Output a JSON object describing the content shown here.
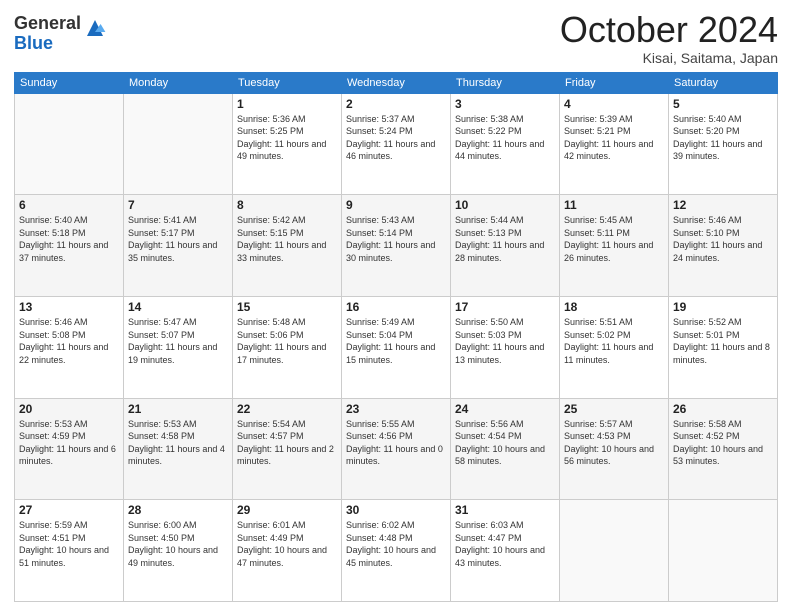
{
  "header": {
    "logo_general": "General",
    "logo_blue": "Blue",
    "month_title": "October 2024",
    "location": "Kisai, Saitama, Japan"
  },
  "weekdays": [
    "Sunday",
    "Monday",
    "Tuesday",
    "Wednesday",
    "Thursday",
    "Friday",
    "Saturday"
  ],
  "weeks": [
    [
      {
        "day": "",
        "info": ""
      },
      {
        "day": "",
        "info": ""
      },
      {
        "day": "1",
        "info": "Sunrise: 5:36 AM\nSunset: 5:25 PM\nDaylight: 11 hours and 49 minutes."
      },
      {
        "day": "2",
        "info": "Sunrise: 5:37 AM\nSunset: 5:24 PM\nDaylight: 11 hours and 46 minutes."
      },
      {
        "day": "3",
        "info": "Sunrise: 5:38 AM\nSunset: 5:22 PM\nDaylight: 11 hours and 44 minutes."
      },
      {
        "day": "4",
        "info": "Sunrise: 5:39 AM\nSunset: 5:21 PM\nDaylight: 11 hours and 42 minutes."
      },
      {
        "day": "5",
        "info": "Sunrise: 5:40 AM\nSunset: 5:20 PM\nDaylight: 11 hours and 39 minutes."
      }
    ],
    [
      {
        "day": "6",
        "info": "Sunrise: 5:40 AM\nSunset: 5:18 PM\nDaylight: 11 hours and 37 minutes."
      },
      {
        "day": "7",
        "info": "Sunrise: 5:41 AM\nSunset: 5:17 PM\nDaylight: 11 hours and 35 minutes."
      },
      {
        "day": "8",
        "info": "Sunrise: 5:42 AM\nSunset: 5:15 PM\nDaylight: 11 hours and 33 minutes."
      },
      {
        "day": "9",
        "info": "Sunrise: 5:43 AM\nSunset: 5:14 PM\nDaylight: 11 hours and 30 minutes."
      },
      {
        "day": "10",
        "info": "Sunrise: 5:44 AM\nSunset: 5:13 PM\nDaylight: 11 hours and 28 minutes."
      },
      {
        "day": "11",
        "info": "Sunrise: 5:45 AM\nSunset: 5:11 PM\nDaylight: 11 hours and 26 minutes."
      },
      {
        "day": "12",
        "info": "Sunrise: 5:46 AM\nSunset: 5:10 PM\nDaylight: 11 hours and 24 minutes."
      }
    ],
    [
      {
        "day": "13",
        "info": "Sunrise: 5:46 AM\nSunset: 5:08 PM\nDaylight: 11 hours and 22 minutes."
      },
      {
        "day": "14",
        "info": "Sunrise: 5:47 AM\nSunset: 5:07 PM\nDaylight: 11 hours and 19 minutes."
      },
      {
        "day": "15",
        "info": "Sunrise: 5:48 AM\nSunset: 5:06 PM\nDaylight: 11 hours and 17 minutes."
      },
      {
        "day": "16",
        "info": "Sunrise: 5:49 AM\nSunset: 5:04 PM\nDaylight: 11 hours and 15 minutes."
      },
      {
        "day": "17",
        "info": "Sunrise: 5:50 AM\nSunset: 5:03 PM\nDaylight: 11 hours and 13 minutes."
      },
      {
        "day": "18",
        "info": "Sunrise: 5:51 AM\nSunset: 5:02 PM\nDaylight: 11 hours and 11 minutes."
      },
      {
        "day": "19",
        "info": "Sunrise: 5:52 AM\nSunset: 5:01 PM\nDaylight: 11 hours and 8 minutes."
      }
    ],
    [
      {
        "day": "20",
        "info": "Sunrise: 5:53 AM\nSunset: 4:59 PM\nDaylight: 11 hours and 6 minutes."
      },
      {
        "day": "21",
        "info": "Sunrise: 5:53 AM\nSunset: 4:58 PM\nDaylight: 11 hours and 4 minutes."
      },
      {
        "day": "22",
        "info": "Sunrise: 5:54 AM\nSunset: 4:57 PM\nDaylight: 11 hours and 2 minutes."
      },
      {
        "day": "23",
        "info": "Sunrise: 5:55 AM\nSunset: 4:56 PM\nDaylight: 11 hours and 0 minutes."
      },
      {
        "day": "24",
        "info": "Sunrise: 5:56 AM\nSunset: 4:54 PM\nDaylight: 10 hours and 58 minutes."
      },
      {
        "day": "25",
        "info": "Sunrise: 5:57 AM\nSunset: 4:53 PM\nDaylight: 10 hours and 56 minutes."
      },
      {
        "day": "26",
        "info": "Sunrise: 5:58 AM\nSunset: 4:52 PM\nDaylight: 10 hours and 53 minutes."
      }
    ],
    [
      {
        "day": "27",
        "info": "Sunrise: 5:59 AM\nSunset: 4:51 PM\nDaylight: 10 hours and 51 minutes."
      },
      {
        "day": "28",
        "info": "Sunrise: 6:00 AM\nSunset: 4:50 PM\nDaylight: 10 hours and 49 minutes."
      },
      {
        "day": "29",
        "info": "Sunrise: 6:01 AM\nSunset: 4:49 PM\nDaylight: 10 hours and 47 minutes."
      },
      {
        "day": "30",
        "info": "Sunrise: 6:02 AM\nSunset: 4:48 PM\nDaylight: 10 hours and 45 minutes."
      },
      {
        "day": "31",
        "info": "Sunrise: 6:03 AM\nSunset: 4:47 PM\nDaylight: 10 hours and 43 minutes."
      },
      {
        "day": "",
        "info": ""
      },
      {
        "day": "",
        "info": ""
      }
    ]
  ]
}
